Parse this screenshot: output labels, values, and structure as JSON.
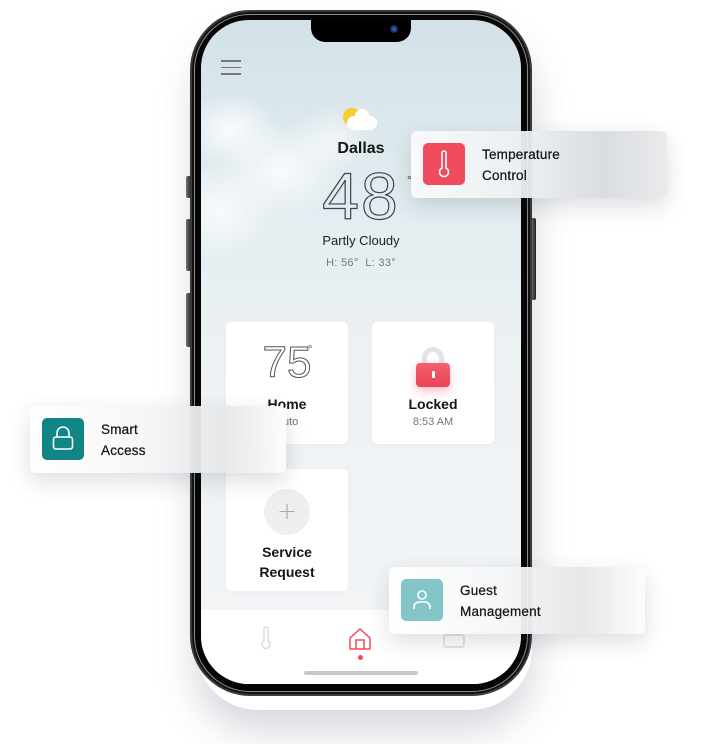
{
  "screen": {
    "city": "Dallas",
    "temperature": "48",
    "temperature_unit": "°",
    "condition": "Partly Cloudy",
    "high_low": "H: 56°  L: 33°",
    "weather_icon": "partly-cloudy-icon",
    "menu_icon": "hamburger-menu-icon"
  },
  "cards": {
    "home": {
      "temperature": "75",
      "unit": "°",
      "title": "Home",
      "subtitle": "Auto"
    },
    "lock": {
      "title": "Locked",
      "subtitle": "8:53 AM",
      "icon": "padlock-icon",
      "accent": "#ef4b5c"
    },
    "service": {
      "title_line1": "Service",
      "title_line2": "Request",
      "icon": "plus-icon"
    }
  },
  "tabbar": {
    "tabs": [
      {
        "name": "temperature",
        "icon": "thermometer-icon",
        "active": false
      },
      {
        "name": "home",
        "icon": "home-icon",
        "active": true
      },
      {
        "name": "other",
        "icon": "briefcase-icon",
        "active": false
      }
    ],
    "active_color": "#ef4b5c"
  },
  "features": {
    "temperature": {
      "line1": "Temperature",
      "line2": "Control",
      "icon": "thermometer-icon",
      "color": "#ef4b5c"
    },
    "smart_access": {
      "line1": "Smart",
      "line2": "Access",
      "icon": "lock-icon",
      "color": "#0f8585"
    },
    "guest": {
      "line1": "Guest",
      "line2": "Management",
      "icon": "user-icon",
      "color": "#84c5c7"
    }
  }
}
